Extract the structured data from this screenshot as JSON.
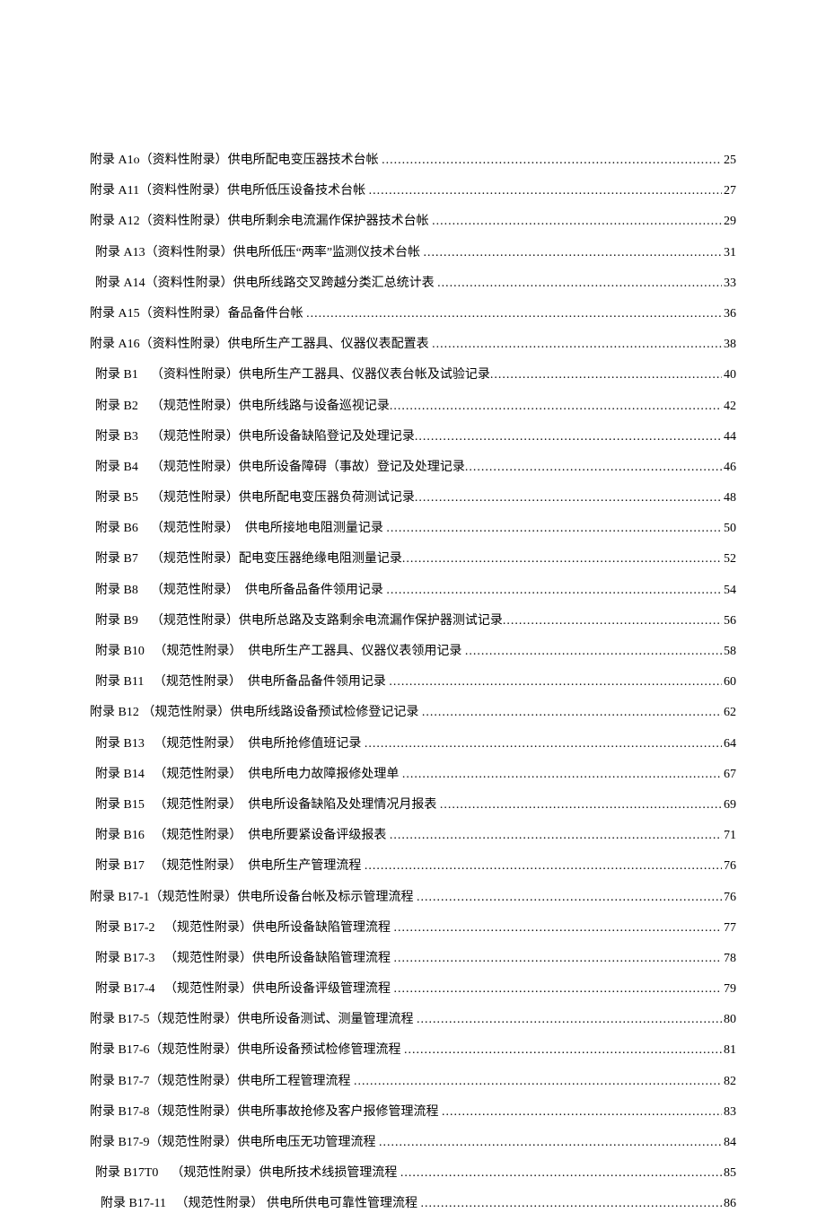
{
  "toc": [
    {
      "label": "附录 A1o（资料性附录）供电所配电变压器技术台帐 ",
      "page": "25",
      "indent": 0
    },
    {
      "label": "附录 A11（资料性附录）供电所低压设备技术台帐 ",
      "page": "27",
      "indent": 0
    },
    {
      "label": "附录 A12（资料性附录）供电所剩余电流漏作保护器技术台帐 ",
      "page": "29",
      "indent": 0
    },
    {
      "label": "附录 A13（资料性附录）供电所低压“两率”监测仪技术台帐 ",
      "page": "31",
      "indent": 1
    },
    {
      "label": "附录 A14（资料性附录）供电所线路交叉跨越分类汇总统计表 ",
      "page": "33",
      "indent": 1
    },
    {
      "label": "附录 A15（资料性附录）备品备件台帐 ",
      "page": "36",
      "indent": 0
    },
    {
      "label": "附录 A16（资料性附录）供电所生产工器具、仪器仪表配置表 ",
      "page": "38",
      "indent": 0
    },
    {
      "label": "附录 B1    （资料性附录）供电所生产工器具、仪器仪表台帐及试验记录",
      "page": " 40",
      "indent": 1
    },
    {
      "label": "附录 B2    （规范性附录）供电所线路与设备巡视记录",
      "page": " 42",
      "indent": 1
    },
    {
      "label": "附录 B3    （规范性附录）供电所设备缺陷登记及处理记录",
      "page": " 44",
      "indent": 1
    },
    {
      "label": "附录 B4    （规范性附录）供电所设备障碍（事故）登记及处理记录",
      "page": " 46",
      "indent": 1
    },
    {
      "label": "附录 B5    （规范性附录）供电所配电变压器负荷测试记录",
      "page": " 48",
      "indent": 1
    },
    {
      "label": "附录 B6    （规范性附录）  供电所接地电阻测量记录 ",
      "page": "50",
      "indent": 1
    },
    {
      "label": "附录 B7    （规范性附录）配电变压器绝缘电阻测量记录",
      "page": "52",
      "indent": 1
    },
    {
      "label": "附录 B8    （规范性附录）  供电所备品备件领用记录 ",
      "page": "54",
      "indent": 1
    },
    {
      "label": "附录 B9    （规范性附录）供电所总路及支路剩余电流漏作保护器测试记录",
      "page": "56",
      "indent": 1
    },
    {
      "label": "附录 B10   （规范性附录）  供电所生产工器具、仪器仪表领用记录 ",
      "page": "58",
      "indent": 1
    },
    {
      "label": "附录 B11   （规范性附录）  供电所备品备件领用记录 ",
      "page": "60",
      "indent": 1
    },
    {
      "label": "附录 B12 （规范性附录）供电所线路设备预试检修登记记录 ",
      "page": "62",
      "indent": 0
    },
    {
      "label": "附录 B13   （规范性附录）  供电所抢修值班记录 ",
      "page": "64",
      "indent": 1
    },
    {
      "label": "附录 B14   （规范性附录）  供电所电力故障报修处理单 ",
      "page": "67",
      "indent": 1
    },
    {
      "label": "附录 B15   （规范性附录）  供电所设备缺陷及处理情况月报表 ",
      "page": "69",
      "indent": 1
    },
    {
      "label": "附录 B16   （规范性附录）  供电所要紧设备评级报表 ",
      "page": "71",
      "indent": 1
    },
    {
      "label": "附录 B17   （规范性附录）  供电所生产管理流程 ",
      "page": "76",
      "indent": 1
    },
    {
      "label": "附录 B17-1（规范性附录）供电所设备台帐及标示管理流程 ",
      "page": "76",
      "indent": 0
    },
    {
      "label": "附录 B17-2   （规范性附录）供电所设备缺陷管理流程 ",
      "page": "77",
      "indent": 1
    },
    {
      "label": "附录 B17-3   （规范性附录）供电所设备缺陷管理流程 ",
      "page": "78",
      "indent": 1
    },
    {
      "label": "附录 B17-4   （规范性附录）供电所设备评级管理流程 ",
      "page": "79",
      "indent": 1
    },
    {
      "label": "附录 B17-5（规范性附录）供电所设备测试、测量管理流程 ",
      "page": "80",
      "indent": 0
    },
    {
      "label": "附录 B17-6（规范性附录）供电所设备预试检修管理流程 ",
      "page": "81",
      "indent": 0
    },
    {
      "label": "附录 B17-7（规范性附录）供电所工程管理流程 ",
      "page": "82",
      "indent": 0
    },
    {
      "label": "附录 B17-8（规范性附录）供电所事故抢修及客户报修管理流程 ",
      "page": "83",
      "indent": 0
    },
    {
      "label": "附录 B17-9（规范性附录）供电所电压无功管理流程 ",
      "page": "84",
      "indent": 0
    },
    {
      "label": "附录 B17T0    （规范性附录）供电所技术线损管理流程 ",
      "page": "85",
      "indent": 1
    },
    {
      "label": "附录 B17-11   （规范性附录） 供电所供电可靠性管理流程 ",
      "page": "86",
      "indent": 2
    }
  ]
}
